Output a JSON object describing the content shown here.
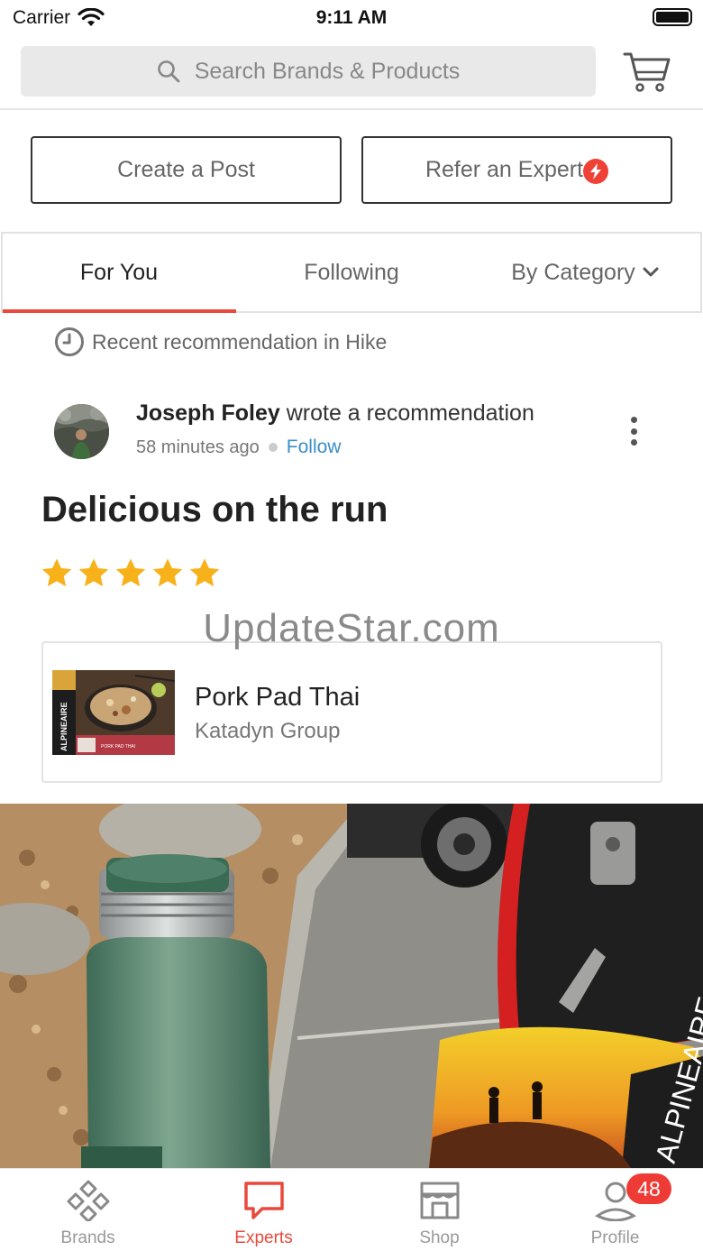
{
  "status_bar": {
    "carrier": "Carrier",
    "time": "9:11 AM"
  },
  "header": {
    "search_placeholder": "Search Brands & Products"
  },
  "actions": {
    "create_post": "Create a Post",
    "refer_expert": "Refer an Expert"
  },
  "tabs": {
    "for_you": "For You",
    "following": "Following",
    "by_category": "By Category",
    "active": "For You"
  },
  "context": {
    "text": "Recent recommendation in Hike"
  },
  "post": {
    "author": "Joseph Foley",
    "action_text": "wrote a recommendation",
    "time_ago": "58 minutes ago",
    "follow_label": "Follow",
    "title": "Delicious on the run",
    "rating": 5,
    "rating_max": 5
  },
  "watermark": "UpdateStar.com",
  "product": {
    "name": "Pork Pad Thai",
    "brand": "Katadyn Group",
    "thumb_brand": "ALPINEAIRE",
    "thumb_label": "PORK PAD THAI"
  },
  "photo": {
    "bag_brand": "ALPINEAIRE"
  },
  "tabbar": {
    "brands": "Brands",
    "experts": "Experts",
    "shop": "Shop",
    "profile": "Profile",
    "profile_badge": "48",
    "active": "Experts"
  },
  "colors": {
    "accent": "#e8493b",
    "link": "#3a8ec8",
    "star": "#f7b21b",
    "badge": "#ef3b36"
  }
}
